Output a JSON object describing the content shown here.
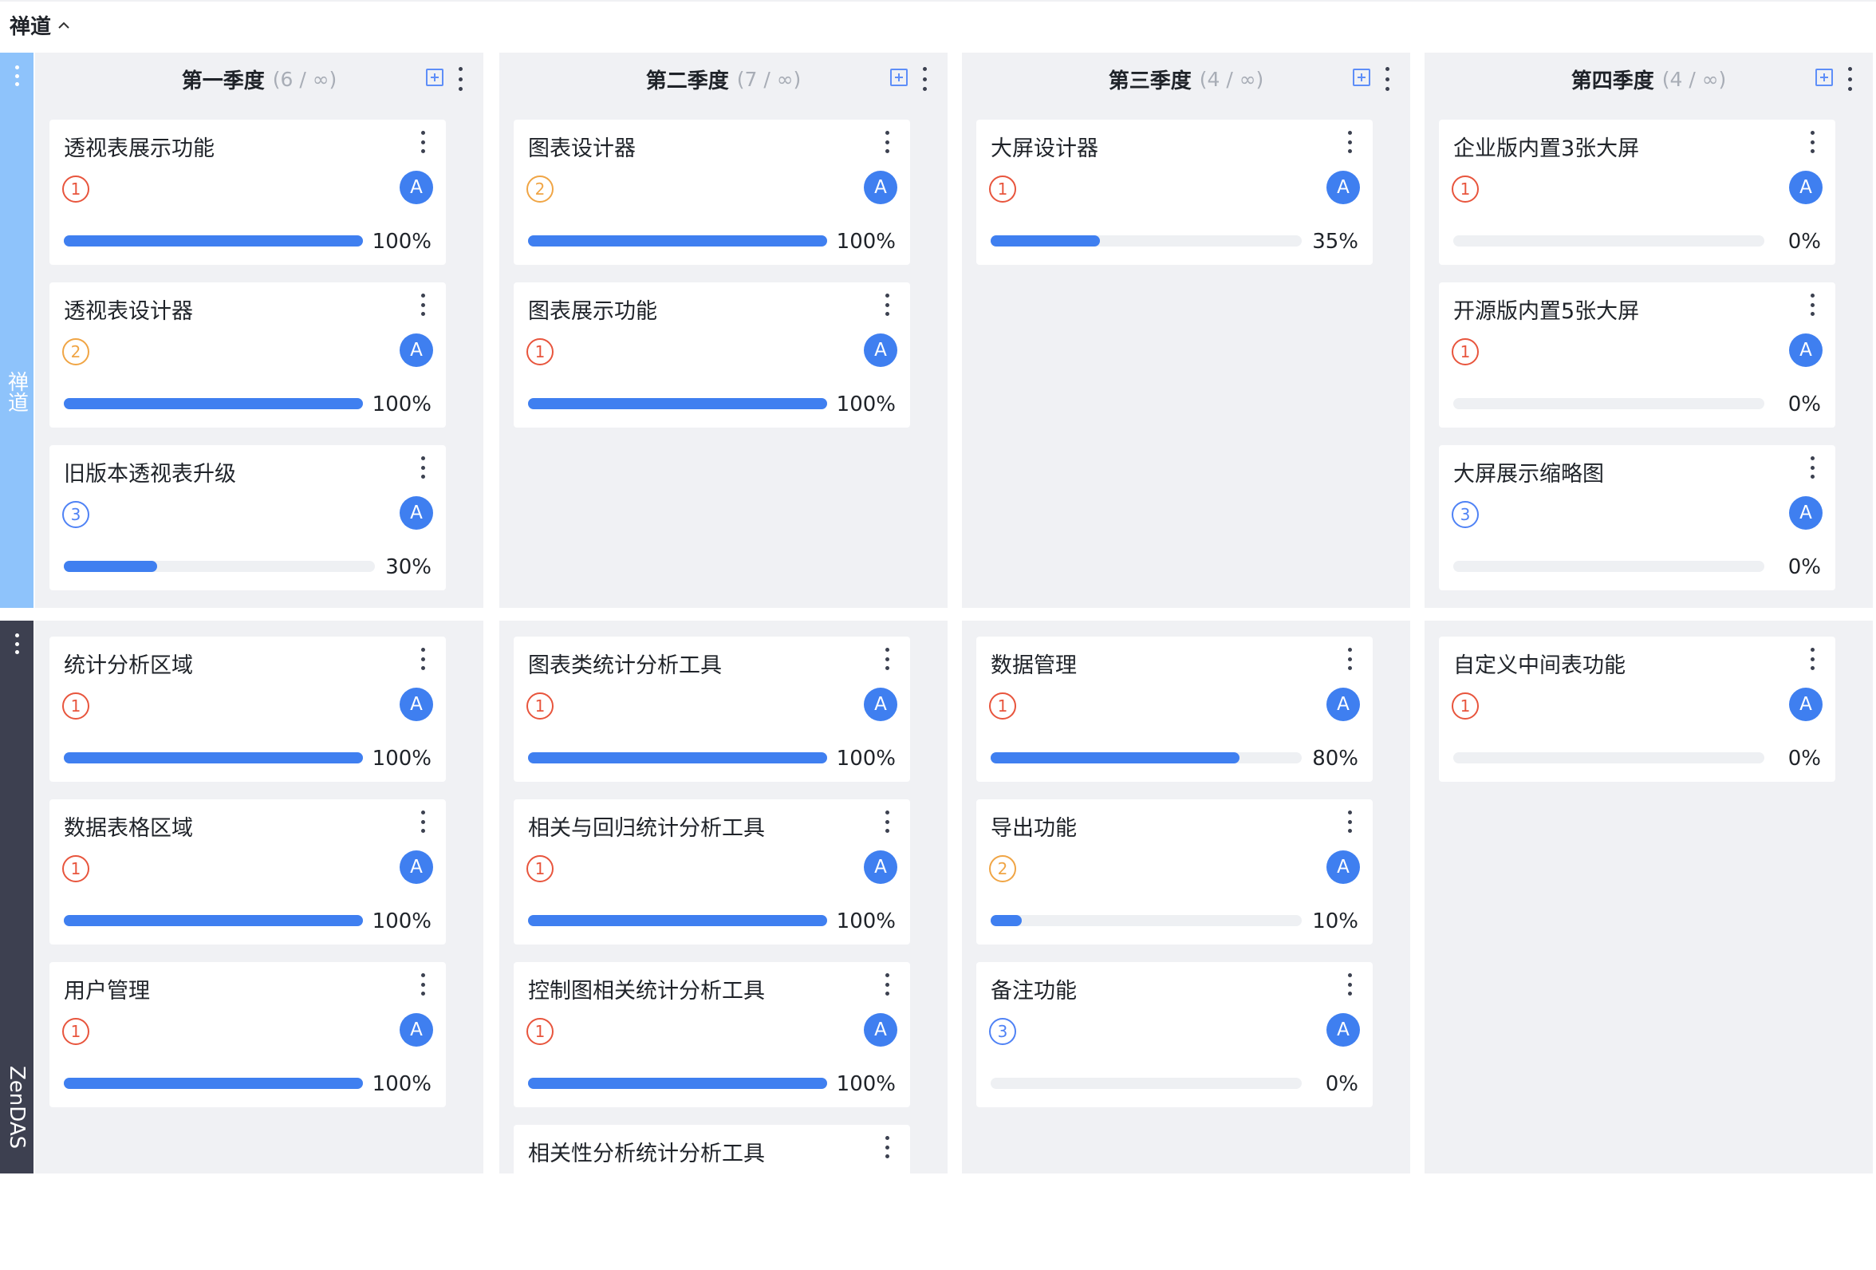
{
  "board": {
    "title": "禅道",
    "toggle_icon": "chevron-up-icon"
  },
  "columns": [
    {
      "name": "第一季度",
      "count": "(6 / ∞)"
    },
    {
      "name": "第二季度",
      "count": "(7 / ∞)"
    },
    {
      "name": "第三季度",
      "count": "(4 / ∞)"
    },
    {
      "name": "第四季度",
      "count": "(4 / ∞)"
    }
  ],
  "lanes": [
    {
      "name": "禅道",
      "color": "#8ec3fb"
    },
    {
      "name": "ZenDAS",
      "color": "#3d4050"
    }
  ],
  "avatar_letter": "A",
  "cards": {
    "lane0": [
      [
        {
          "title": "透视表展示功能",
          "priority": "1",
          "progress": 100,
          "progress_label": "100%"
        },
        {
          "title": "透视表设计器",
          "priority": "2",
          "progress": 100,
          "progress_label": "100%"
        },
        {
          "title": "旧版本透视表升级",
          "priority": "3",
          "progress": 30,
          "progress_label": "30%"
        }
      ],
      [
        {
          "title": "图表设计器",
          "priority": "2",
          "progress": 100,
          "progress_label": "100%"
        },
        {
          "title": "图表展示功能",
          "priority": "1",
          "progress": 100,
          "progress_label": "100%"
        }
      ],
      [
        {
          "title": "大屏设计器",
          "priority": "1",
          "progress": 35,
          "progress_label": "35%"
        }
      ],
      [
        {
          "title": "企业版内置3张大屏",
          "priority": "1",
          "progress": 0,
          "progress_label": "0%"
        },
        {
          "title": "开源版内置5张大屏",
          "priority": "1",
          "progress": 0,
          "progress_label": "0%"
        },
        {
          "title": "大屏展示缩略图",
          "priority": "3",
          "progress": 0,
          "progress_label": "0%"
        }
      ]
    ],
    "lane1": [
      [
        {
          "title": "统计分析区域",
          "priority": "1",
          "progress": 100,
          "progress_label": "100%"
        },
        {
          "title": "数据表格区域",
          "priority": "1",
          "progress": 100,
          "progress_label": "100%"
        },
        {
          "title": "用户管理",
          "priority": "1",
          "progress": 100,
          "progress_label": "100%"
        }
      ],
      [
        {
          "title": "图表类统计分析工具",
          "priority": "1",
          "progress": 100,
          "progress_label": "100%"
        },
        {
          "title": "相关与回归统计分析工具",
          "priority": "1",
          "progress": 100,
          "progress_label": "100%"
        },
        {
          "title": "控制图相关统计分析工具",
          "priority": "1",
          "progress": 100,
          "progress_label": "100%"
        },
        {
          "title": "相关性分析统计分析工具",
          "priority": "",
          "progress": null,
          "progress_label": ""
        }
      ],
      [
        {
          "title": "数据管理",
          "priority": "1",
          "progress": 80,
          "progress_label": "80%"
        },
        {
          "title": "导出功能",
          "priority": "2",
          "progress": 10,
          "progress_label": "10%"
        },
        {
          "title": "备注功能",
          "priority": "3",
          "progress": 0,
          "progress_label": "0%"
        }
      ],
      [
        {
          "title": "自定义中间表功能",
          "priority": "1",
          "progress": 0,
          "progress_label": "0%"
        }
      ]
    ]
  }
}
